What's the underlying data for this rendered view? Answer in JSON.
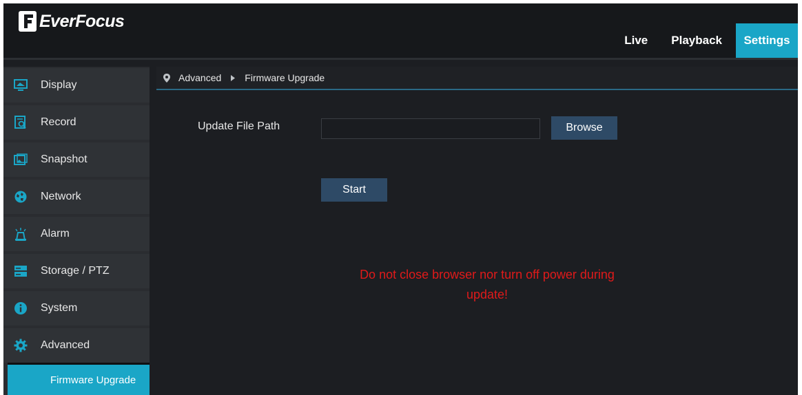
{
  "brand": {
    "name": "EverFocus"
  },
  "top_nav": {
    "live": "Live",
    "playback": "Playback",
    "settings": "Settings",
    "active": "Settings"
  },
  "sidebar": {
    "items": [
      {
        "label": "Display",
        "icon": "display-icon"
      },
      {
        "label": "Record",
        "icon": "record-icon"
      },
      {
        "label": "Snapshot",
        "icon": "snapshot-icon"
      },
      {
        "label": "Network",
        "icon": "network-icon"
      },
      {
        "label": "Alarm",
        "icon": "alarm-icon"
      },
      {
        "label": "Storage / PTZ",
        "icon": "storage-icon"
      },
      {
        "label": "System",
        "icon": "info-icon"
      },
      {
        "label": "Advanced",
        "icon": "gear-icon"
      }
    ],
    "active_sub": "Firmware Upgrade"
  },
  "breadcrumb": {
    "section": "Advanced",
    "page": "Firmware Upgrade"
  },
  "form": {
    "path_label": "Update File Path",
    "path_value": "",
    "browse_label": "Browse",
    "start_label": "Start"
  },
  "warning": {
    "line1": "Do not close browser nor turn off power during",
    "line2": "update!"
  },
  "colors": {
    "accent": "#1aa6c7",
    "button": "#2e4a66",
    "warning": "#e01a1a",
    "background": "#1c1e22"
  }
}
